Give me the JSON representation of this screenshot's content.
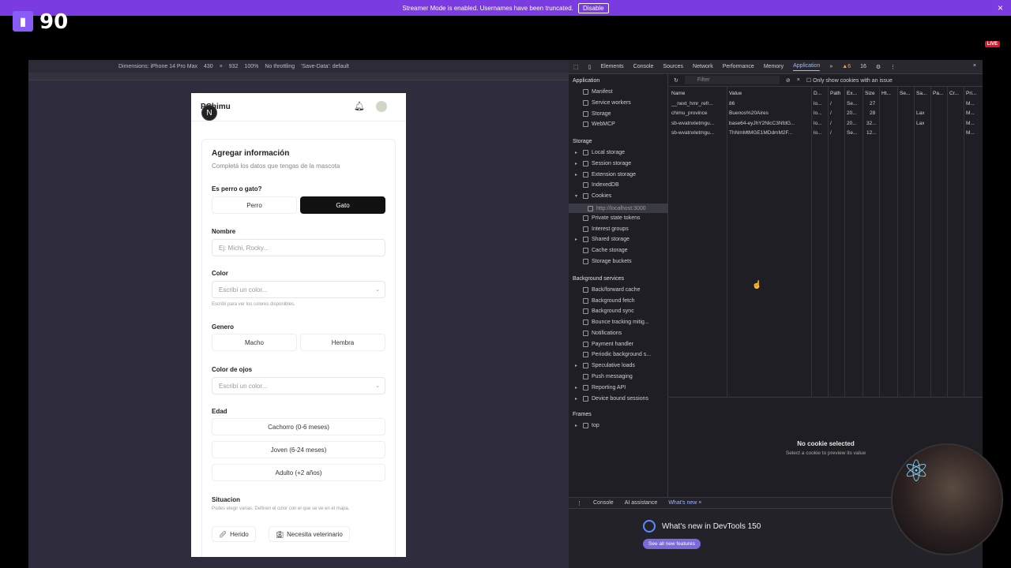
{
  "banner": {
    "message": "Streamer Mode is enabled. Usernames have been truncated.",
    "disable_label": "Disable"
  },
  "stream": {
    "viewer_count": "90",
    "live_label": "LIVE"
  },
  "device_toolbar": {
    "dimensions_label": "Dimensions: iPhone 14 Pro Max",
    "width": "430",
    "times": "×",
    "height": "932",
    "zoom": "100%",
    "throttling": "No throttling",
    "save_data": "'Save-Data': default"
  },
  "app": {
    "brand": "Chimu",
    "brand_prefix": "P",
    "n_badge": "N",
    "card_title": "Agregar información",
    "card_subtitle": "Completá los datos que tengas de la mascota",
    "type_label": "Es perro o gato?",
    "type_options": [
      "Perro",
      "Gato"
    ],
    "name_label": "Nombre",
    "name_placeholder": "Ej: Michi, Rocky...",
    "color_label": "Color",
    "color_placeholder": "Escribí un color...",
    "color_hint": "Escribí para ver los colores disponibles.",
    "gender_label": "Genero",
    "gender_options": [
      "Macho",
      "Hembra"
    ],
    "eye_label": "Color de ojos",
    "eye_placeholder": "Escribí un color...",
    "age_label": "Edad",
    "age_options": [
      "Cachorro (0-6 meses)",
      "Joven (6-24 meses)",
      "Adulto (+2 años)"
    ],
    "situation_label": "Situacion",
    "situation_hint": "Podes elegir varias. Definen el color con el que se ve en el mapa.",
    "situation_options": [
      "Herido",
      "Necesita veterinario"
    ]
  },
  "devtools": {
    "tabs": [
      "Elements",
      "Console",
      "Sources",
      "Network",
      "Performance",
      "Memory",
      "Application",
      "»"
    ],
    "active_tab": "Application",
    "issues": "6",
    "count": "16",
    "sidebar": {
      "application_header": "Application",
      "application_items": [
        "Manifest",
        "Service workers",
        "Storage",
        "WebMCP"
      ],
      "storage_header": "Storage",
      "storage_items": [
        "Local storage",
        "Session storage",
        "Extension storage",
        "IndexedDB",
        "Cookies"
      ],
      "cookie_origin": "http://localhost:3000",
      "storage_items_2": [
        "Private state tokens",
        "Interest groups",
        "Shared storage",
        "Cache storage",
        "Storage buckets"
      ],
      "bg_header": "Background services",
      "bg_items": [
        "Back/forward cache",
        "Background fetch",
        "Background sync",
        "Bounce tracking mitig...",
        "Notifications",
        "Payment handler",
        "Periodic background s...",
        "Speculative loads",
        "Push messaging",
        "Reporting API",
        "Device bound sessions"
      ],
      "frames_header": "Frames",
      "frames_items": [
        "top"
      ]
    },
    "filter_placeholder": "Filter",
    "only_issue_label": "Only show cookies with an issue",
    "columns": [
      "Name",
      "Value",
      "D...",
      "Path",
      "Ex...",
      "Size",
      "Ht...",
      "Se...",
      "Sa...",
      "Pa...",
      "Cr...",
      "Pri..."
    ],
    "rows": [
      {
        "name": "__next_hmr_refr...",
        "value": "86",
        "domain": "lo...",
        "path": "/",
        "expires": "Se...",
        "size": "27",
        "samesite": "",
        "priority": "M..."
      },
      {
        "name": "chimu_province",
        "value": "Buenos%20Aires",
        "domain": "lo...",
        "path": "/",
        "expires": "20...",
        "size": "28",
        "samesite": "Lax",
        "priority": "M..."
      },
      {
        "name": "sb-wvatnxletmgu...",
        "value": "base64-eyJhY2NlcC3NfdG...",
        "domain": "lo...",
        "path": "/",
        "expires": "20...",
        "size": "32...",
        "samesite": "Lax",
        "priority": "M..."
      },
      {
        "name": "sb-wvatnxletmgu...",
        "value": "ThNmMtMGE1MDdmM2F...",
        "domain": "lo...",
        "path": "/",
        "expires": "Se...",
        "size": "12...",
        "samesite": "",
        "priority": "M..."
      }
    ],
    "no_cookie_title": "No cookie selected",
    "no_cookie_sub": "Select a cookie to preview its value",
    "drawer_tabs": [
      "Console",
      "AI assistance",
      "What's new"
    ],
    "whats_new_title": "What's new in DevTools 150",
    "see_features": "See all new features"
  }
}
